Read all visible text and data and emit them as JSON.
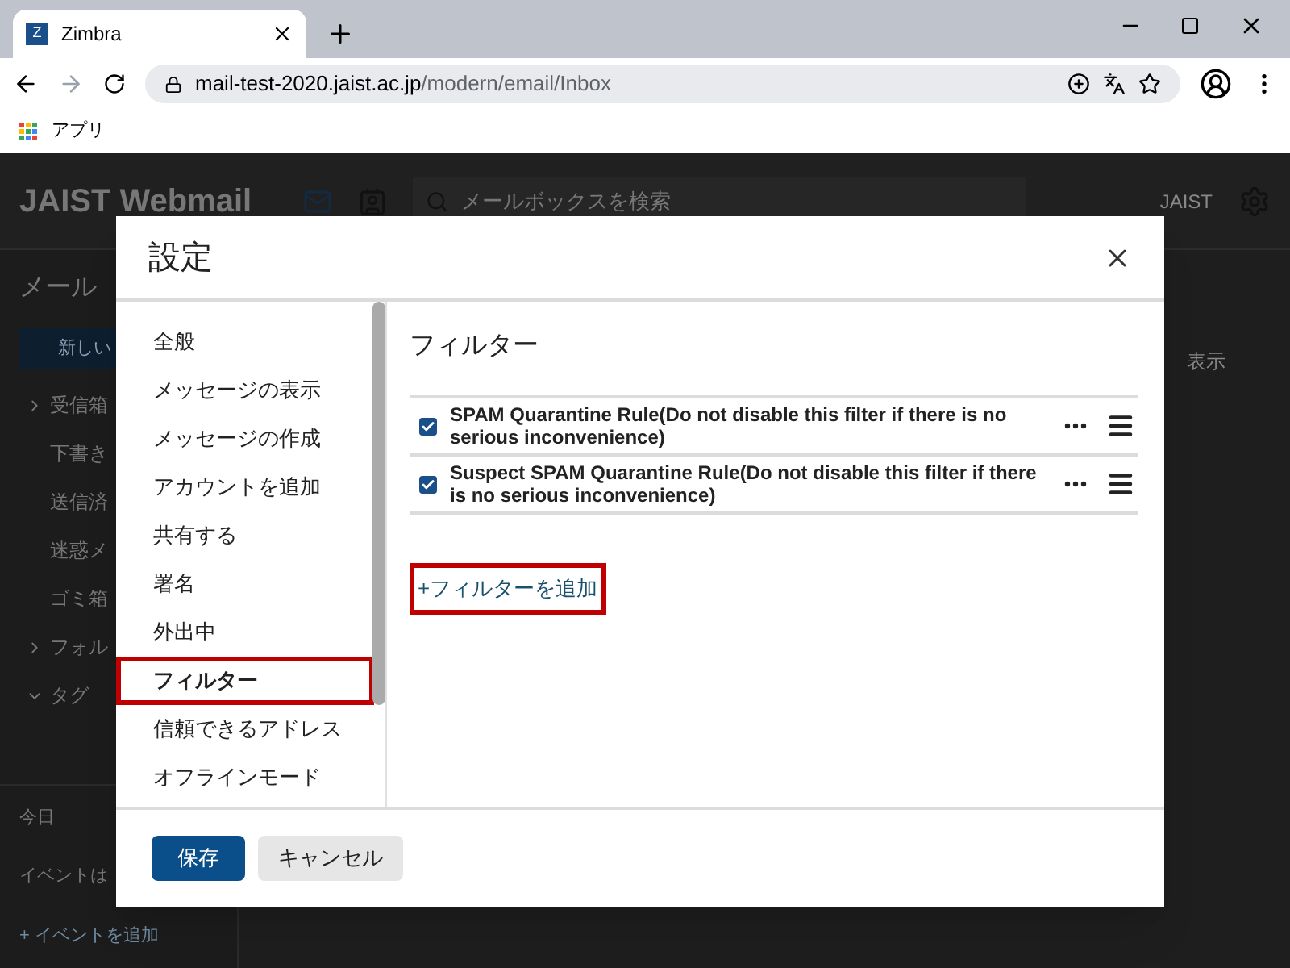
{
  "browser": {
    "tab_title": "Zimbra",
    "favicon": "Z",
    "url_host": "mail-test-2020.jaist.ac.jp",
    "url_path": "/modern/email/Inbox",
    "bookmarks": [
      "アプリ"
    ]
  },
  "app": {
    "logo": "JAIST Webmail",
    "search_placeholder": "メールボックスを検索",
    "user": "JAIST",
    "view_menu": "表示",
    "sidebar": {
      "heading": "メール",
      "new_button": "新しい",
      "folders": [
        {
          "label": "受信箱",
          "expanded": false
        },
        {
          "label": "下書き"
        },
        {
          "label": "送信済"
        },
        {
          "label": "迷惑メ"
        },
        {
          "label": "ゴミ箱"
        },
        {
          "label": "フォル",
          "expanded": false
        },
        {
          "label": "タグ",
          "expanded": true
        }
      ],
      "calendar": {
        "today": "今日",
        "no_events": "イベントは",
        "add_event": "+ イベントを追加"
      }
    }
  },
  "dialog": {
    "title": "設定",
    "nav": [
      {
        "label": "全般",
        "selected": false
      },
      {
        "label": "メッセージの表示",
        "selected": false
      },
      {
        "label": "メッセージの作成",
        "selected": false
      },
      {
        "label": "アカウントを追加",
        "selected": false
      },
      {
        "label": "共有する",
        "selected": false
      },
      {
        "label": "署名",
        "selected": false
      },
      {
        "label": "外出中",
        "selected": false
      },
      {
        "label": "フィルター",
        "selected": true
      },
      {
        "label": "信頼できるアドレス",
        "selected": false
      },
      {
        "label": "オフラインモード",
        "selected": false
      }
    ],
    "section_title": "フィルター",
    "filters": [
      {
        "name": "SPAM Quarantine Rule(Do not disable this filter if there is no serious inconvenience)",
        "checked": true
      },
      {
        "name": "Suspect SPAM Quarantine Rule(Do not disable this filter if there is no serious inconvenience)",
        "checked": true
      }
    ],
    "add_filter": "+フィルターを追加",
    "buttons": {
      "save": "保存",
      "cancel": "キャンセル"
    }
  }
}
